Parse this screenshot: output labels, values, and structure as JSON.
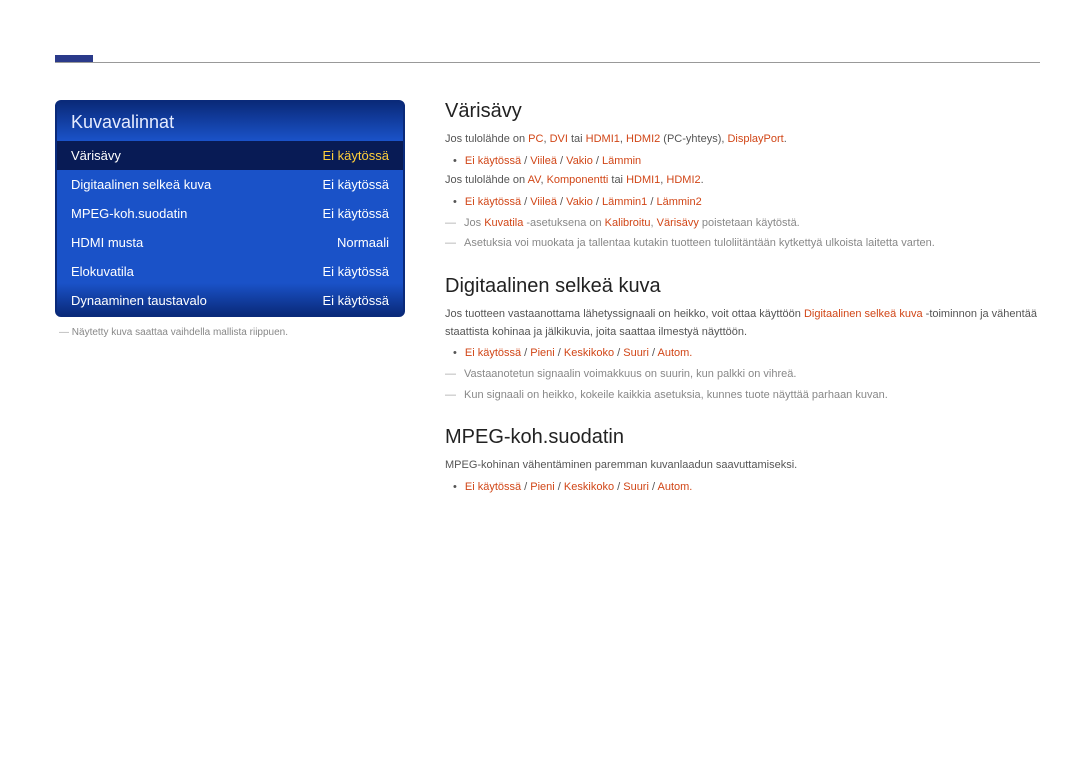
{
  "panel": {
    "title": "Kuvavalinnat",
    "rows": [
      {
        "label": "Värisävy",
        "value": "Ei käytössä",
        "selected": true
      },
      {
        "label": "Digitaalinen selkeä kuva",
        "value": "Ei käytössä",
        "selected": false
      },
      {
        "label": "MPEG-koh.suodatin",
        "value": "Ei käytössä",
        "selected": false
      },
      {
        "label": "HDMI musta",
        "value": "Normaali",
        "selected": false
      },
      {
        "label": "Elokuvatila",
        "value": "Ei käytössä",
        "selected": false
      },
      {
        "label": "Dynaaminen taustavalo",
        "value": "Ei käytössä",
        "selected": false
      }
    ],
    "footnote": "Näytetty kuva saattaa vaihdella mallista riippuen."
  },
  "sections": {
    "varisavy": {
      "title": "Värisävy",
      "line1_a": "Jos tulolähde on ",
      "line1_b": "PC",
      "line1_c": ", ",
      "line1_d": "DVI",
      "line1_e": " tai ",
      "line1_f": "HDMI1",
      "line1_g": ", ",
      "line1_h": "HDMI2",
      "line1_i": " (PC-yhteys), ",
      "line1_j": "DisplayPort",
      "line1_k": ".",
      "bullet1_a": "Ei käytössä",
      "bullet1_b": "Viileä",
      "bullet1_c": "Vakio",
      "bullet1_d": "Lämmin",
      "line2_a": "Jos tulolähde on ",
      "line2_b": "AV",
      "line2_c": ", ",
      "line2_d": "Komponentti",
      "line2_e": " tai ",
      "line2_f": "HDMI1",
      "line2_g": ", ",
      "line2_h": "HDMI2",
      "line2_i": ".",
      "bullet2_a": "Ei käytössä",
      "bullet2_b": "Viileä",
      "bullet2_c": "Vakio",
      "bullet2_d": "Lämmin1",
      "bullet2_e": "Lämmin2",
      "note1_a": "Jos ",
      "note1_b": "Kuvatila",
      "note1_c": " -asetuksena on ",
      "note1_d": "Kalibroitu",
      "note1_e": ", ",
      "note1_f": "Värisävy",
      "note1_g": " poistetaan käytöstä.",
      "note2": "Asetuksia voi muokata ja tallentaa kutakin tuotteen tuloliitäntään kytkettyä ulkoista laitetta varten."
    },
    "digital": {
      "title": "Digitaalinen selkeä kuva",
      "p1_a": "Jos tuotteen vastaanottama lähetyssignaali on heikko, voit ottaa käyttöön ",
      "p1_b": "Digitaalinen selkeä kuva",
      "p1_c": " -toiminnon ja vähentää staattista kohinaa ja jälkikuvia, joita saattaa ilmestyä näyttöön.",
      "bullet_a": "Ei käytössä",
      "bullet_b": "Pieni",
      "bullet_c": "Keskikoko",
      "bullet_d": "Suuri",
      "bullet_e": "Autom.",
      "note1": "Vastaanotetun signaalin voimakkuus on suurin, kun palkki on vihreä.",
      "note2": "Kun signaali on heikko, kokeile kaikkia asetuksia, kunnes tuote näyttää parhaan kuvan."
    },
    "mpeg": {
      "title": "MPEG-koh.suodatin",
      "p1": "MPEG-kohinan vähentäminen paremman kuvanlaadun saavuttamiseksi.",
      "bullet_a": "Ei käytössä",
      "bullet_b": "Pieni",
      "bullet_c": "Keskikoko",
      "bullet_d": "Suuri",
      "bullet_e": "Autom."
    }
  }
}
